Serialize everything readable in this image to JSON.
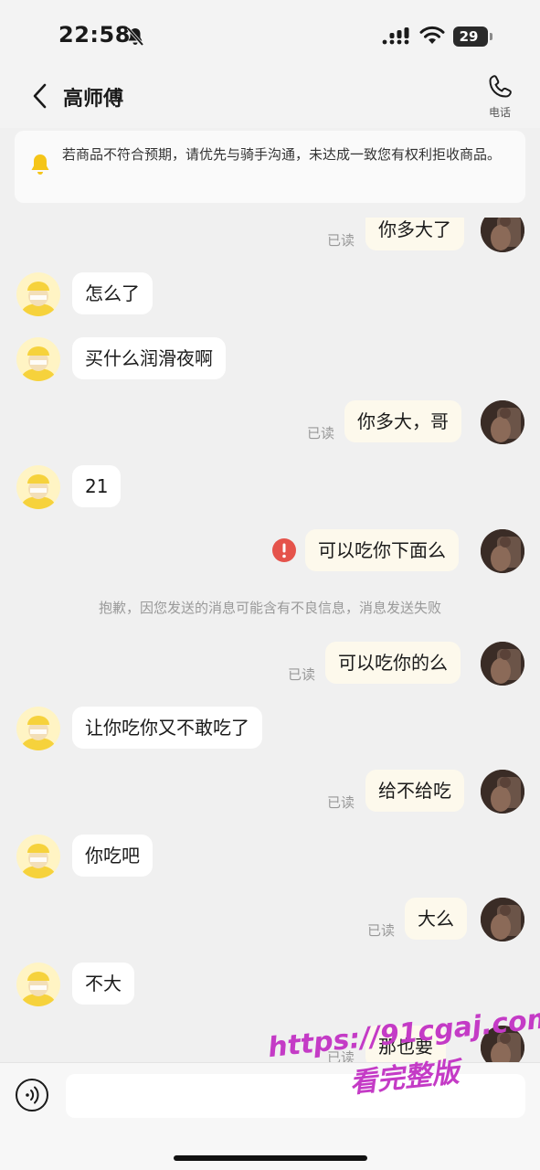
{
  "status_bar": {
    "time": "22:58",
    "battery": "29"
  },
  "header": {
    "title": "高师傅",
    "phone_label": "电话"
  },
  "notice": {
    "text": "若商品不符合预期，请优先与骑手沟通，未达成一致您有权利拒收商品。"
  },
  "messages": [
    {
      "side": "out",
      "text": "你多大了",
      "status": "已读"
    },
    {
      "side": "in",
      "text": "怎么了"
    },
    {
      "side": "in",
      "text": "买什么润滑夜啊"
    },
    {
      "side": "out",
      "text": "你多大，哥",
      "status": "已读"
    },
    {
      "side": "in",
      "text": "21"
    },
    {
      "side": "out",
      "text": "可以吃你下面么",
      "failed": true
    },
    {
      "side": "out",
      "text": "可以吃你的么",
      "status": "已读"
    },
    {
      "side": "in",
      "text": "让你吃你又不敢吃了"
    },
    {
      "side": "out",
      "text": "给不给吃",
      "status": "已读"
    },
    {
      "side": "in",
      "text": "你吃吧"
    },
    {
      "side": "out",
      "text": "大么",
      "status": "已读"
    },
    {
      "side": "in",
      "text": "不大"
    },
    {
      "side": "out",
      "text": "那也要",
      "status": "已读"
    }
  ],
  "system_note": "抱歉，因您发送的消息可能含有不良信息，消息发送失败",
  "input": {
    "value": "",
    "placeholder": ""
  },
  "watermark": {
    "line1": "https://91cgaj.com",
    "line2": "看完整版"
  },
  "colors": {
    "incoming_bubble": "#ffffff",
    "outgoing_bubble": "#fdf9ec",
    "error": "#e5534b",
    "background": "#f0f0f0",
    "watermark": "#c43bc6"
  }
}
